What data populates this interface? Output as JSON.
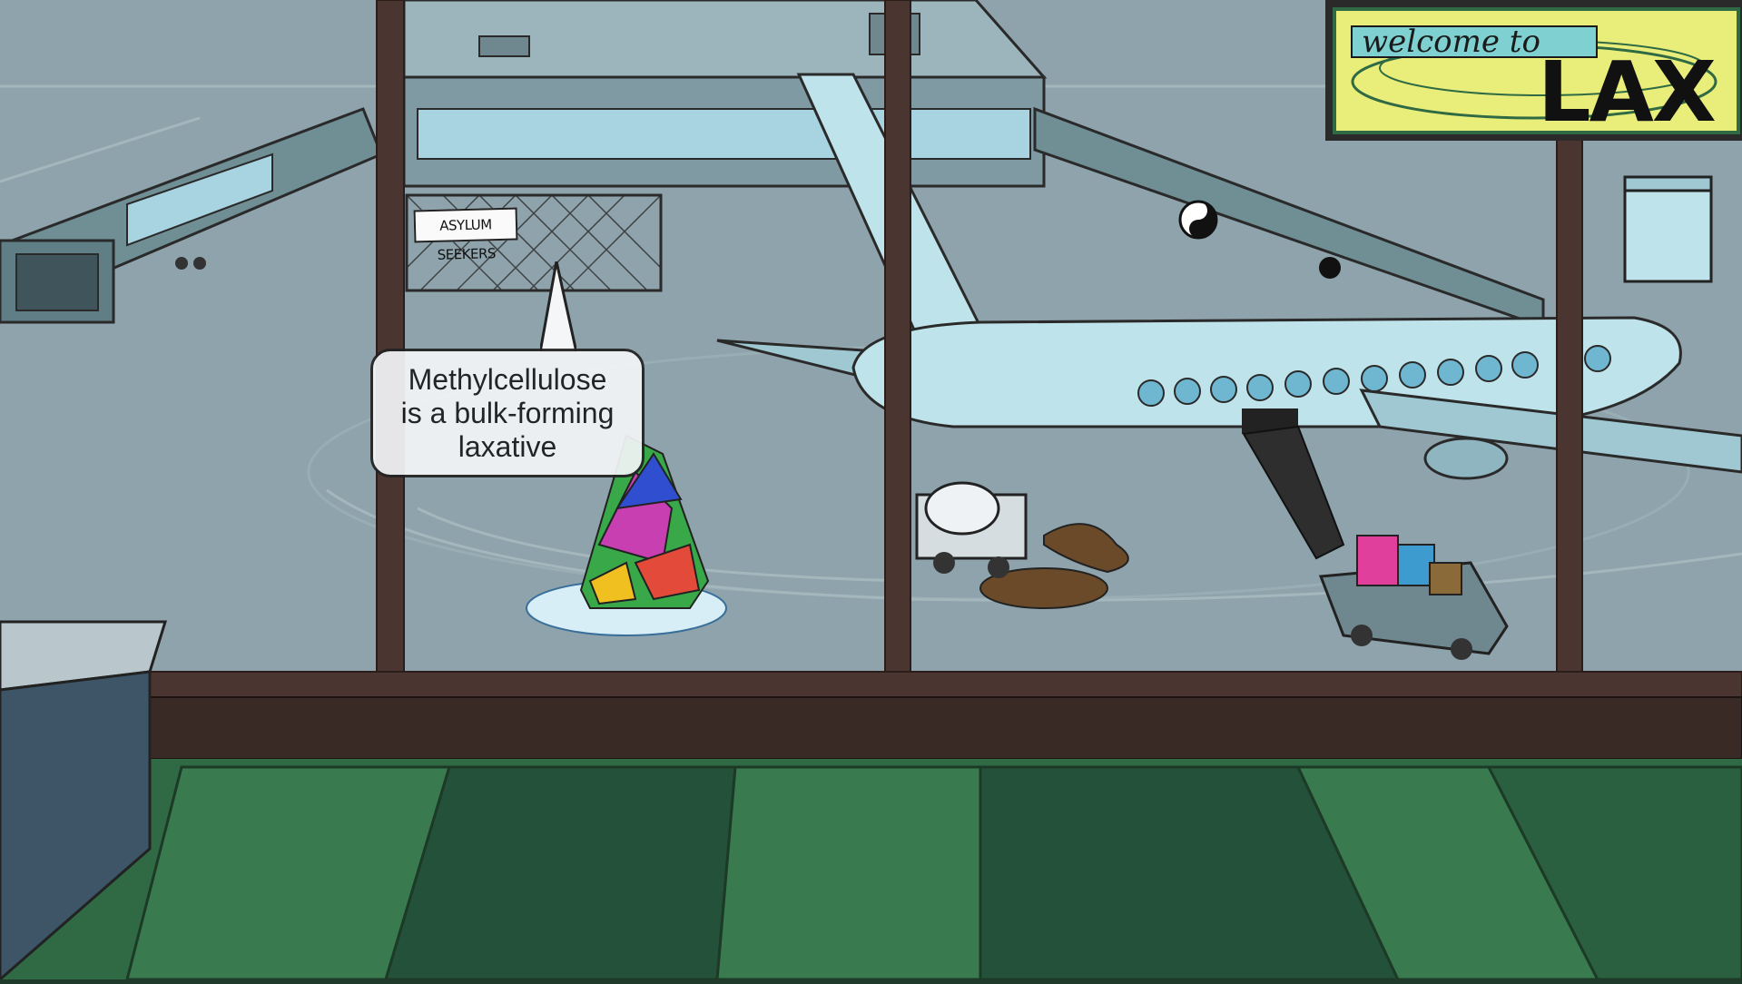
{
  "callout": {
    "lines": [
      "Methylcellulose",
      "is a bulk-forming",
      "laxative"
    ]
  },
  "sign": {
    "small_text": "welcome to",
    "big_text": "LAX"
  },
  "fence_sign": {
    "text": "ASYLUM SEEKERS"
  },
  "colors": {
    "floor": "#2f6a44",
    "floor_dark": "#23513a",
    "window_frame": "#4a3530",
    "tarmac": "#8ea3ab",
    "sign_yellow": "#e9ee7a",
    "sign_green": "#2f6a44",
    "plane": "#bfe3ea"
  }
}
